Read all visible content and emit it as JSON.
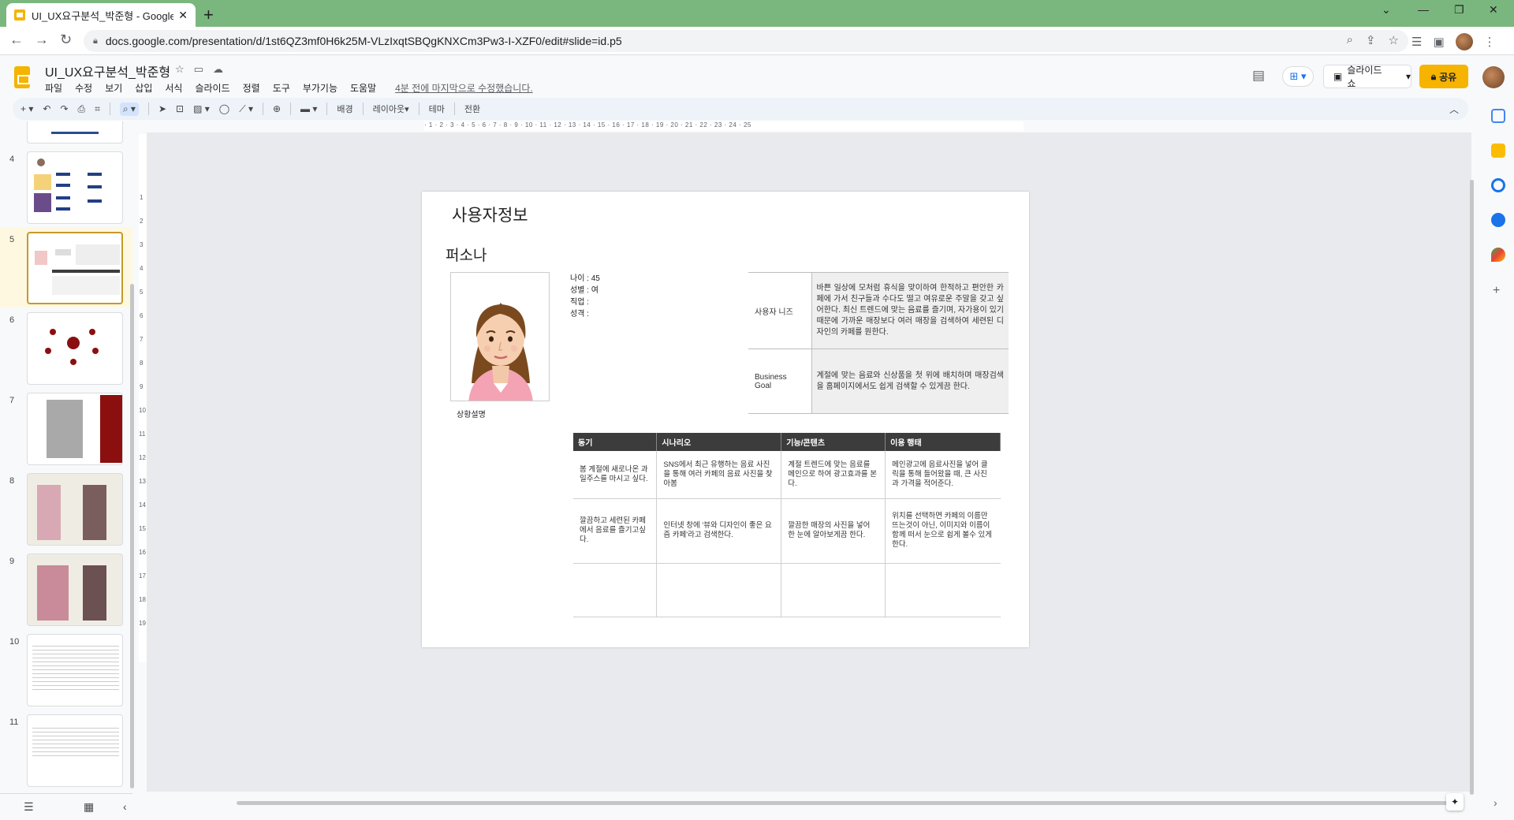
{
  "browser": {
    "tab_title": "UI_UX요구분석_박준형 - Google",
    "tab_close": "✕",
    "new_tab": "+",
    "url": "docs.google.com/presentation/d/1st6QZ3mf0H6k25M-VLzIxqtSBQgKNXCm3Pw3-I-XZF0/edit#slide=id.p5"
  },
  "doc": {
    "title": "UI_UX요구분석_박준형",
    "last_edit": "4분 전에 마지막으로 수정했습니다.",
    "menu": [
      "파일",
      "수정",
      "보기",
      "삽입",
      "서식",
      "슬라이드",
      "정렬",
      "도구",
      "부가기능",
      "도움말"
    ],
    "slideshow_label": "슬라이드쇼",
    "share_label": "공유"
  },
  "toolbar": {
    "background": "배경",
    "layout": "레이아웃▾",
    "theme": "테마",
    "transition": "전환"
  },
  "filmstrip": {
    "numbers": [
      "4",
      "5",
      "6",
      "7",
      "8",
      "9",
      "10",
      "11"
    ],
    "selected": "5"
  },
  "ruler": {
    "h_marks": "· 1 · 2 · 3 · 4 · 5 · 6 · 7 · 8 · 9 · 10 · 11 · 12 · 13 · 14 · 15 · 16 · 17 · 18 · 19 · 20 · 21 · 22 · 23 · 24 · 25",
    "v_marks": [
      "1",
      "2",
      "3",
      "4",
      "5",
      "6",
      "7",
      "8",
      "9",
      "10",
      "11",
      "12",
      "13",
      "14",
      "15",
      "16",
      "17",
      "18",
      "19"
    ]
  },
  "slide": {
    "title": "사용자정보",
    "persona_label": "퍼소나",
    "situation_label": "상황설명",
    "info": {
      "age": "나이 : 45",
      "gender": "성별 : 여",
      "job": "직업 :",
      "personality": "성격 :"
    },
    "needs": [
      {
        "key": "사용자 니즈",
        "value": "바쁜 일상에 모처럼 휴식을 맞이하여 한적하고 편안한 카페에 가서 친구들과 수다도 떨고 여유로운 주말을 갖고 싶어한다. 최신 트렌드에 맞는 음료를 즐기며, 자가용이 있기 때문에 가까운 매장보다 여러 매장을 검색하여 세련된 디자인의 카페를 원한다."
      },
      {
        "key": "Business Goal",
        "value": "계절에 맞는 음료와 신상품을 첫 위에 배치하며 매장검색을 홈페이지에서도 쉽게 검색할 수 있게끔 한다."
      }
    ],
    "table": {
      "headers": [
        "동기",
        "시나리오",
        "기능/콘텐츠",
        "이용 행태"
      ],
      "rows": [
        [
          "봄 계절에 새로나온 과일주스를 마시고 싶다.",
          "SNS에서 최근 유행하는 음료 사진을 통해 여러 카페의 음료 사진을 찾아봄",
          "계절 트렌드에 맞는 음료를 메인으로 하여 광고효과를 본다.",
          "메인광고에 음료사진을 넣어 클릭을 통해 들어왔을 때, 큰 사진과 가격을 적어준다."
        ],
        [
          "깔끔하고 세련된 카페에서 음료를 즐기고싶다.",
          "인터넷 창에 '뷰와 디자인이 좋은 요즘 카페'라고 검색한다.",
          "깔끔한 매장의 사진을 넣어 한 눈에 알아보게끔 한다.",
          "위치를 선택하면 카페의 이름만 뜨는것이 아닌, 이미지와 이름이 함께 떠서 눈으로 쉽게 볼수 있게한다."
        ],
        [
          "",
          "",
          "",
          ""
        ]
      ]
    }
  },
  "colors": {
    "tabstrip": "#7ab77e",
    "accent": "#f6b400",
    "table_header": "#3c3c3c",
    "selected_thumb": "#c59a2a"
  }
}
